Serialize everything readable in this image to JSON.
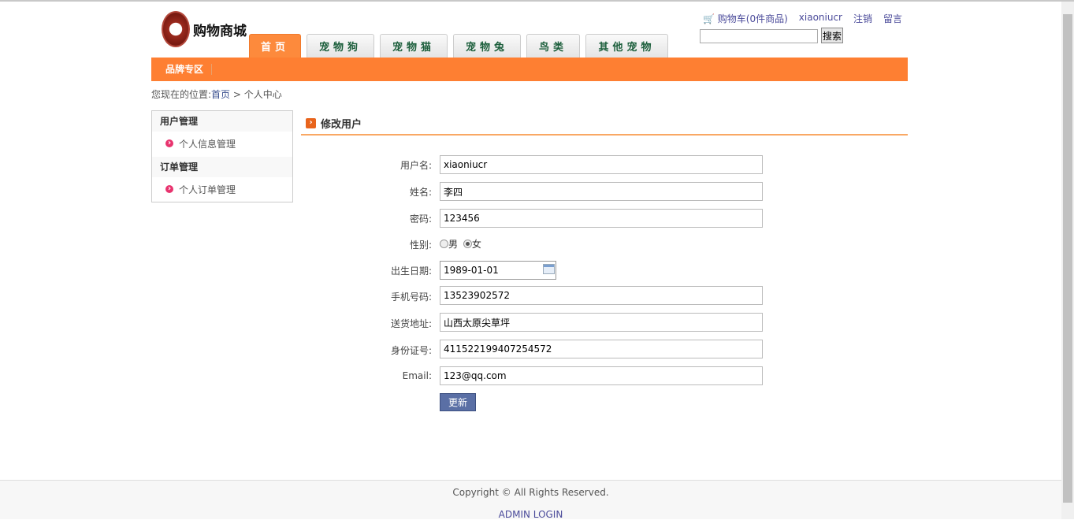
{
  "logo": {
    "text": "购物商城"
  },
  "tabs": [
    "首页",
    "宠物狗",
    "宠物猫",
    "宠物兔",
    "鸟类",
    "其他宠物"
  ],
  "nav": {
    "brand": "品牌专区"
  },
  "toplinks": {
    "cart": "购物车(0件商品)",
    "user": "xiaoniucr",
    "logout": "注销",
    "message": "留言"
  },
  "search": {
    "button": "搜索",
    "value": ""
  },
  "breadcrumb": {
    "prefix": "您现在的位置:",
    "home": "首页",
    "sep": ">",
    "current": "个人中心"
  },
  "sidebar": {
    "group1": "用户管理",
    "item1": "个人信息管理",
    "group2": "订单管理",
    "item2": "个人订单管理"
  },
  "main": {
    "title": "修改用户"
  },
  "form": {
    "username_label": "用户名:",
    "username": "xiaoniucr",
    "name_label": "姓名:",
    "name": "李四",
    "password_label": "密码:",
    "password": "123456",
    "gender_label": "性别:",
    "male": "男",
    "female": "女",
    "birth_label": "出生日期:",
    "birth": "1989-01-01",
    "phone_label": "手机号码:",
    "phone": "13523902572",
    "address_label": "送货地址:",
    "address": "山西太原尖草坪",
    "id_label": "身份证号:",
    "idcard": "411522199407254572",
    "email_label": "Email:",
    "email": "123@qq.com",
    "submit": "更新"
  },
  "footer": {
    "copyright": "Copyright © All Rights Reserved.",
    "admin": "ADMIN LOGIN"
  }
}
